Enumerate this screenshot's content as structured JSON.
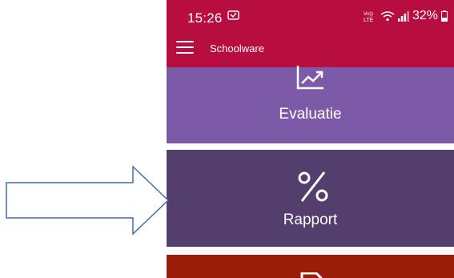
{
  "status_bar": {
    "time": "15:26",
    "network": "LTE",
    "battery": "32%"
  },
  "app_bar": {
    "title": "Schoolware"
  },
  "tiles": [
    {
      "label": "Evaluatie",
      "icon": "trending-chart-icon",
      "color": "#7d5aa7"
    },
    {
      "label": "Rapport",
      "icon": "percent-icon",
      "color": "#533e6e"
    },
    {
      "label": "",
      "icon": "document-icon",
      "color": "#9a1e0a"
    }
  ],
  "colors": {
    "header": "#b80e3f",
    "arrow_stroke": "#3f6fb5"
  },
  "annotation": {
    "icon": "arrow-right-icon"
  }
}
